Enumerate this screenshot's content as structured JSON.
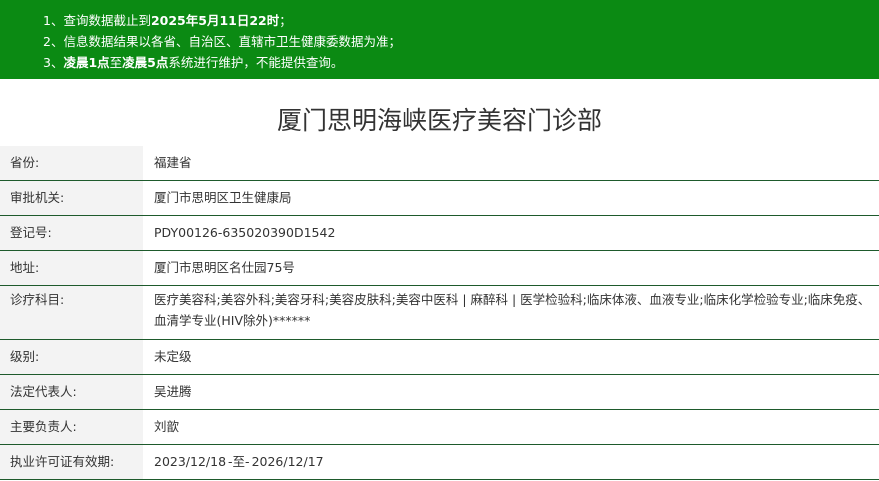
{
  "notice": {
    "line1_prefix": "1、查询数据截止到",
    "line1_bold": "2025年5月11日22时",
    "line1_suffix": "；",
    "line2": "2、信息数据结果以各省、自治区、直辖市卫生健康委数据为准；",
    "line3_prefix": "3、",
    "line3_bold1": "凌晨1点",
    "line3_mid": "至",
    "line3_bold2": "凌晨5点",
    "line3_suffix": "系统进行维护，不能提供查询。",
    "background_color": "#0b8a13"
  },
  "title": "厦门思明海峡医疗美容门诊部",
  "rows": [
    {
      "label": "省份:",
      "value": "福建省"
    },
    {
      "label": "审批机关:",
      "value": "厦门市思明区卫生健康局"
    },
    {
      "label": "登记号:",
      "value": "PDY00126-635020390D1542"
    },
    {
      "label": "地址:",
      "value": "厦门市思明区名仕园75号"
    },
    {
      "label": "诊疗科目:",
      "value": "医疗美容科;美容外科;美容牙科;美容皮肤科;美容中医科 | 麻醉科 | 医学检验科;临床体液、血液专业;临床化学检验专业;临床免疫、血清学专业(HIV除外)******"
    },
    {
      "label": "级别:",
      "value": "未定级"
    },
    {
      "label": "法定代表人:",
      "value": "吴进腾"
    },
    {
      "label": "主要负责人:",
      "value": "刘歆"
    },
    {
      "label": "执业许可证有效期:",
      "value_start": "2023/12/18",
      "value_sep": "-至-",
      "value_end": "2026/12/17"
    }
  ],
  "border_color": "#1e5a2c"
}
